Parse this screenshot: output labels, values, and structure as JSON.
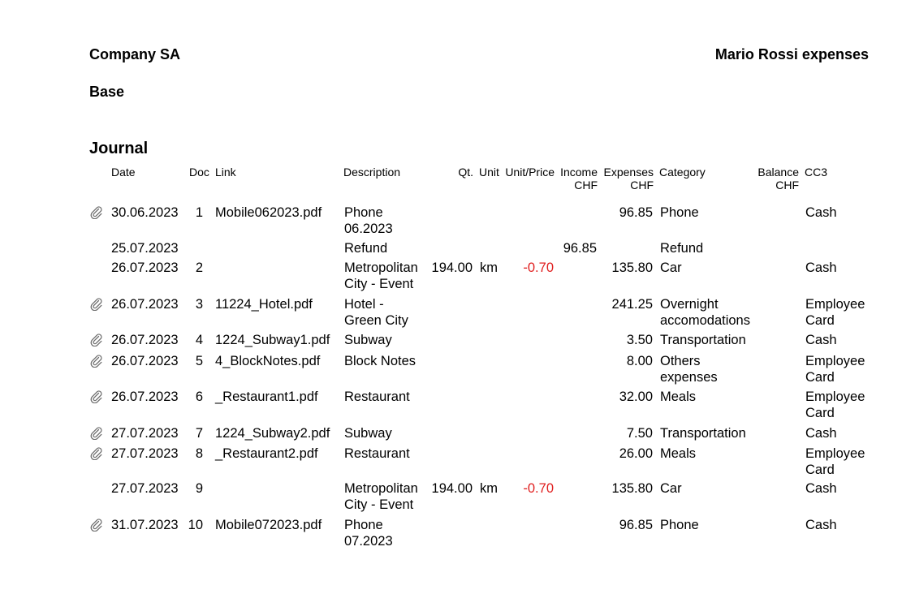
{
  "header": {
    "company": "Company SA",
    "owner_title": "Mario Rossi expenses",
    "section": "Base"
  },
  "journal": {
    "title": "Journal",
    "columns": {
      "date": "Date",
      "doc": "Doc",
      "link": "Link",
      "description": "Description",
      "qty": "Qt.",
      "unit": "Unit",
      "unit_price": "Unit/Price",
      "income": [
        "Income",
        "CHF"
      ],
      "expenses": [
        "Expenses",
        "CHF"
      ],
      "category": "Category",
      "balance": [
        "Balance",
        "CHF"
      ],
      "cc3": "CC3"
    },
    "rows": [
      {
        "attachment": true,
        "date": "30.06.2023",
        "doc": "1",
        "link": "Mobile062023.pdf",
        "description": [
          "Phone",
          "06.2023"
        ],
        "qty": "",
        "unit": "",
        "unit_price": "",
        "income": "",
        "expenses": "96.85",
        "category": [
          "Phone"
        ],
        "balance": "",
        "cc3": [
          "Cash"
        ]
      },
      {
        "attachment": false,
        "date": "25.07.2023",
        "doc": "",
        "link": "",
        "description": [
          "Refund"
        ],
        "qty": "",
        "unit": "",
        "unit_price": "",
        "income": "96.85",
        "expenses": "",
        "category": [
          "Refund"
        ],
        "balance": "",
        "cc3": [
          ""
        ]
      },
      {
        "attachment": false,
        "date": "26.07.2023",
        "doc": "2",
        "link": "",
        "description": [
          "Metropolitan",
          "City - Event"
        ],
        "qty": "194.00",
        "unit": "km",
        "unit_price": "-0.70",
        "income": "",
        "expenses": "135.80",
        "category": [
          "Car"
        ],
        "balance": "",
        "cc3": [
          "Cash"
        ]
      },
      {
        "attachment": true,
        "date": "26.07.2023",
        "doc": "3",
        "link": "11224_Hotel.pdf",
        "description": [
          "Hotel -",
          "Green City"
        ],
        "qty": "",
        "unit": "",
        "unit_price": "",
        "income": "",
        "expenses": "241.25",
        "category": [
          "Overnight",
          "accomodations"
        ],
        "balance": "",
        "cc3": [
          "Employee",
          "Card"
        ]
      },
      {
        "attachment": true,
        "date": "26.07.2023",
        "doc": "4",
        "link": "1224_Subway1.pdf",
        "description": [
          "Subway"
        ],
        "qty": "",
        "unit": "",
        "unit_price": "",
        "income": "",
        "expenses": "3.50",
        "category": [
          "Transportation"
        ],
        "balance": "",
        "cc3": [
          "Cash"
        ]
      },
      {
        "attachment": true,
        "date": "26.07.2023",
        "doc": "5",
        "link": "4_BlockNotes.pdf",
        "description": [
          "Block Notes"
        ],
        "qty": "",
        "unit": "",
        "unit_price": "",
        "income": "",
        "expenses": "8.00",
        "category": [
          "Others",
          "expenses"
        ],
        "balance": "",
        "cc3": [
          "Employee",
          "Card"
        ]
      },
      {
        "attachment": true,
        "date": "26.07.2023",
        "doc": "6",
        "link": "_Restaurant1.pdf",
        "description": [
          "Restaurant"
        ],
        "qty": "",
        "unit": "",
        "unit_price": "",
        "income": "",
        "expenses": "32.00",
        "category": [
          "Meals"
        ],
        "balance": "",
        "cc3": [
          "Employee",
          "Card"
        ]
      },
      {
        "attachment": true,
        "date": "27.07.2023",
        "doc": "7",
        "link": "1224_Subway2.pdf",
        "description": [
          "Subway"
        ],
        "qty": "",
        "unit": "",
        "unit_price": "",
        "income": "",
        "expenses": "7.50",
        "category": [
          "Transportation"
        ],
        "balance": "",
        "cc3": [
          "Cash"
        ]
      },
      {
        "attachment": true,
        "date": "27.07.2023",
        "doc": "8",
        "link": "_Restaurant2.pdf",
        "description": [
          "Restaurant"
        ],
        "qty": "",
        "unit": "",
        "unit_price": "",
        "income": "",
        "expenses": "26.00",
        "category": [
          "Meals"
        ],
        "balance": "",
        "cc3": [
          "Employee",
          "Card"
        ]
      },
      {
        "attachment": false,
        "date": "27.07.2023",
        "doc": "9",
        "link": "",
        "description": [
          "Metropolitan",
          "City - Event"
        ],
        "qty": "194.00",
        "unit": "km",
        "unit_price": "-0.70",
        "income": "",
        "expenses": "135.80",
        "category": [
          "Car"
        ],
        "balance": "",
        "cc3": [
          "Cash"
        ]
      },
      {
        "attachment": true,
        "date": "31.07.2023",
        "doc": "10",
        "link": "Mobile072023.pdf",
        "description": [
          "Phone",
          "07.2023"
        ],
        "qty": "",
        "unit": "",
        "unit_price": "",
        "income": "",
        "expenses": "96.85",
        "category": [
          "Phone"
        ],
        "balance": "",
        "cc3": [
          "Cash"
        ]
      }
    ]
  }
}
